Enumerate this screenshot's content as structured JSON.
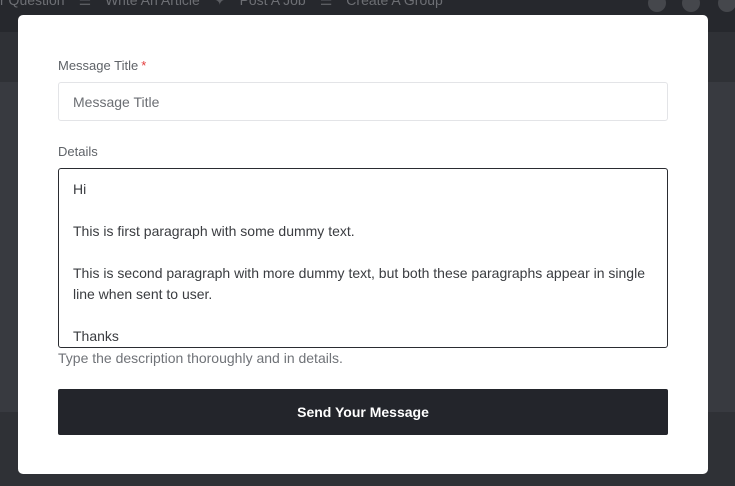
{
  "background": {
    "nav": [
      {
        "label": "r Question",
        "icon": ""
      },
      {
        "label": "Write An Article",
        "icon": "list-icon"
      },
      {
        "label": "Post A Job",
        "icon": "pin-icon"
      },
      {
        "label": "Create A Group",
        "icon": "list-icon"
      }
    ]
  },
  "modal": {
    "title_field": {
      "label": "Message Title",
      "required_mark": "*",
      "placeholder": "Message Title",
      "value": ""
    },
    "details_field": {
      "label": "Details",
      "paragraphs": [
        "Hi",
        "This is first paragraph with some dummy text.",
        "This is second paragraph with more dummy text, but both these paragraphs appear in single line when sent to user.",
        "Thanks"
      ],
      "help_text": "Type the description thoroughly and in details."
    },
    "submit_label": "Send Your Message"
  },
  "colors": {
    "button_bg": "#23252b",
    "required": "#e33b3b",
    "overlay": "#4a4c52"
  }
}
